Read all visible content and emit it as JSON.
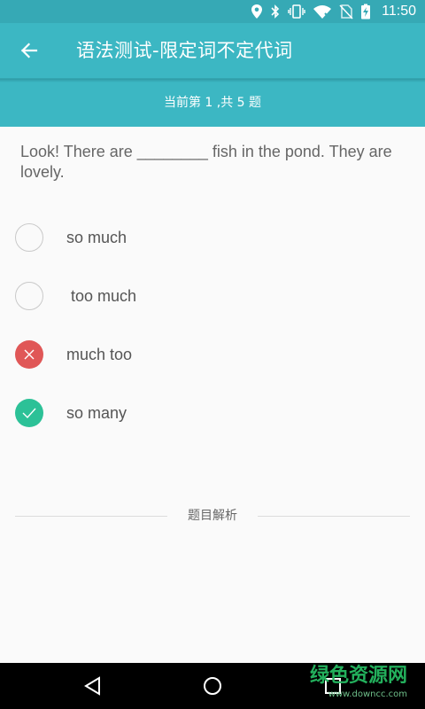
{
  "status_bar": {
    "time": "11:50",
    "icons": [
      "location-icon",
      "bluetooth-icon",
      "vibrate-icon",
      "wifi-icon",
      "no-sim-icon",
      "battery-charging-icon"
    ]
  },
  "header": {
    "title": "语法测试-限定词不定代词",
    "progress": "当前第 1 ,共 5 题"
  },
  "question": {
    "text": "Look! There are ________ fish in the pond. They are lovely."
  },
  "options": [
    {
      "label": "so much",
      "state": "unselected"
    },
    {
      "label": " too much",
      "state": "unselected"
    },
    {
      "label": "much too",
      "state": "wrong"
    },
    {
      "label": "so many",
      "state": "correct"
    }
  ],
  "analysis": {
    "label": "题目解析"
  },
  "watermark": {
    "text": "绿色资源网",
    "url": "www.downcc.com"
  },
  "colors": {
    "primary": "#3cb7c3",
    "wrong": "#e05757",
    "correct": "#2cc197"
  }
}
